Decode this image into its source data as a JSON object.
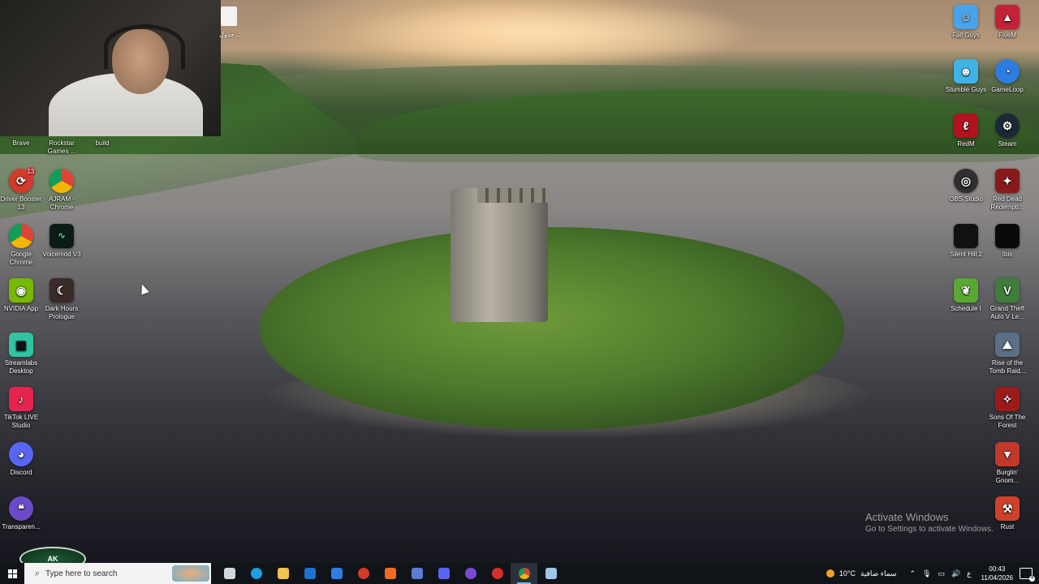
{
  "desktop": {
    "file_label": "جدول...",
    "left_icons": [
      {
        "label": "Brave",
        "icon": "brave-icon",
        "color": "#f06b24"
      },
      {
        "label": "Rockstar Games ...",
        "icon": "rockstar-icon",
        "color": "#f2c200"
      },
      {
        "label": "build",
        "icon": "folder-icon",
        "color": "#e0b542"
      },
      {
        "label": "Driver Booster 13",
        "icon": "driver-booster-icon",
        "color": "#d23b2a",
        "badge": "13"
      },
      {
        "label": "AJRAM - Chrome",
        "icon": "chrome-icon",
        "color": "#2f8f4e"
      },
      {
        "label": "Google Chrome",
        "icon": "chrome-icon",
        "color": "#2f8f4e"
      },
      {
        "label": "Voicemod V3",
        "icon": "voicemod-icon",
        "color": "#0d1b16"
      },
      {
        "label": "NVIDIA App",
        "icon": "nvidia-icon",
        "color": "#76b900"
      },
      {
        "label": "Dark Hours Prologue",
        "icon": "dark-hours-icon",
        "color": "#3b2a2a"
      },
      {
        "label": "Streamlabs Desktop",
        "icon": "streamlabs-icon",
        "color": "#31c3a2"
      },
      {
        "label": "TikTok LIVE Studio",
        "icon": "tiktok-icon",
        "color": "#e5234f"
      },
      {
        "label": "Discord",
        "icon": "discord-icon",
        "color": "#5865f2"
      },
      {
        "label": "Transparen...",
        "icon": "transparent-talk-icon",
        "color": "#6d4ac9"
      }
    ],
    "right_icons": [
      {
        "label": "Fall Guys",
        "icon": "fall-guys-icon",
        "color": "#4aa3e8"
      },
      {
        "label": "FiveM",
        "icon": "fivem-icon",
        "color": "#c4213a"
      },
      {
        "label": "Stumble Guys",
        "icon": "stumble-guys-icon",
        "color": "#3fb3e6"
      },
      {
        "label": "GameLoop",
        "icon": "gameloop-icon",
        "color": "#2d7de0"
      },
      {
        "label": "RedM",
        "icon": "redm-icon",
        "color": "#b3121f"
      },
      {
        "label": "Steam",
        "icon": "steam-icon",
        "color": "#1b2838"
      },
      {
        "label": "OBS Studio",
        "icon": "obs-icon",
        "color": "#302e31"
      },
      {
        "label": "Red Dead Redempti...",
        "icon": "red-dead-icon",
        "color": "#8a1a1a"
      },
      {
        "label": "Silent Hill 2",
        "icon": "silent-hill-icon",
        "color": "#111111"
      },
      {
        "label": "Ibis",
        "icon": "ibis-icon",
        "color": "#0a0a0a"
      },
      {
        "label": "Schedule I",
        "icon": "schedule-icon",
        "color": "#5aa832"
      },
      {
        "label": "Grand Theft Auto V Le...",
        "icon": "gta-icon",
        "color": "#3e7d3a"
      },
      {
        "label": "Rise of the Tomb Raid...",
        "icon": "tomb-raider-icon",
        "color": "#5b6f85"
      },
      {
        "label": "Sons Of The Forest",
        "icon": "sons-forest-icon",
        "color": "#9b1b1b"
      },
      {
        "label": "Burglin' Gnom...",
        "icon": "gnome-icon",
        "color": "#c0392b"
      },
      {
        "label": "Rust",
        "icon": "rust-icon",
        "color": "#cd412b"
      }
    ]
  },
  "watermark": {
    "title": "Activate Windows",
    "subtitle": "Go to Settings to activate Windows."
  },
  "streamer_logo": "AK",
  "taskbar": {
    "search_placeholder": "Type here to search",
    "apps": [
      {
        "name": "task-view",
        "color": "#cfd8dc"
      },
      {
        "name": "edge",
        "color": "#1f9ede"
      },
      {
        "name": "file-explorer",
        "color": "#f2c14e"
      },
      {
        "name": "outlook",
        "color": "#1f6fd0"
      },
      {
        "name": "microsoft-store",
        "color": "#2f7de1"
      },
      {
        "name": "driver-booster",
        "color": "#d23b2a"
      },
      {
        "name": "brave",
        "color": "#f06b24"
      },
      {
        "name": "streamlabs",
        "color": "#5b7bd5"
      },
      {
        "name": "discord",
        "color": "#5865f2"
      },
      {
        "name": "twitch-helper",
        "color": "#7b49d6"
      },
      {
        "name": "chrome-red",
        "color": "#d32f2f"
      },
      {
        "name": "chrome",
        "color": "#2f8f4e",
        "active": true
      },
      {
        "name": "notepad",
        "color": "#9ec6e8"
      }
    ],
    "weather_temp": "10°C",
    "weather_desc": "سماء صافية",
    "language": "ع",
    "time": "00:43",
    "date": "11/04/2026",
    "notification_count": "4"
  }
}
